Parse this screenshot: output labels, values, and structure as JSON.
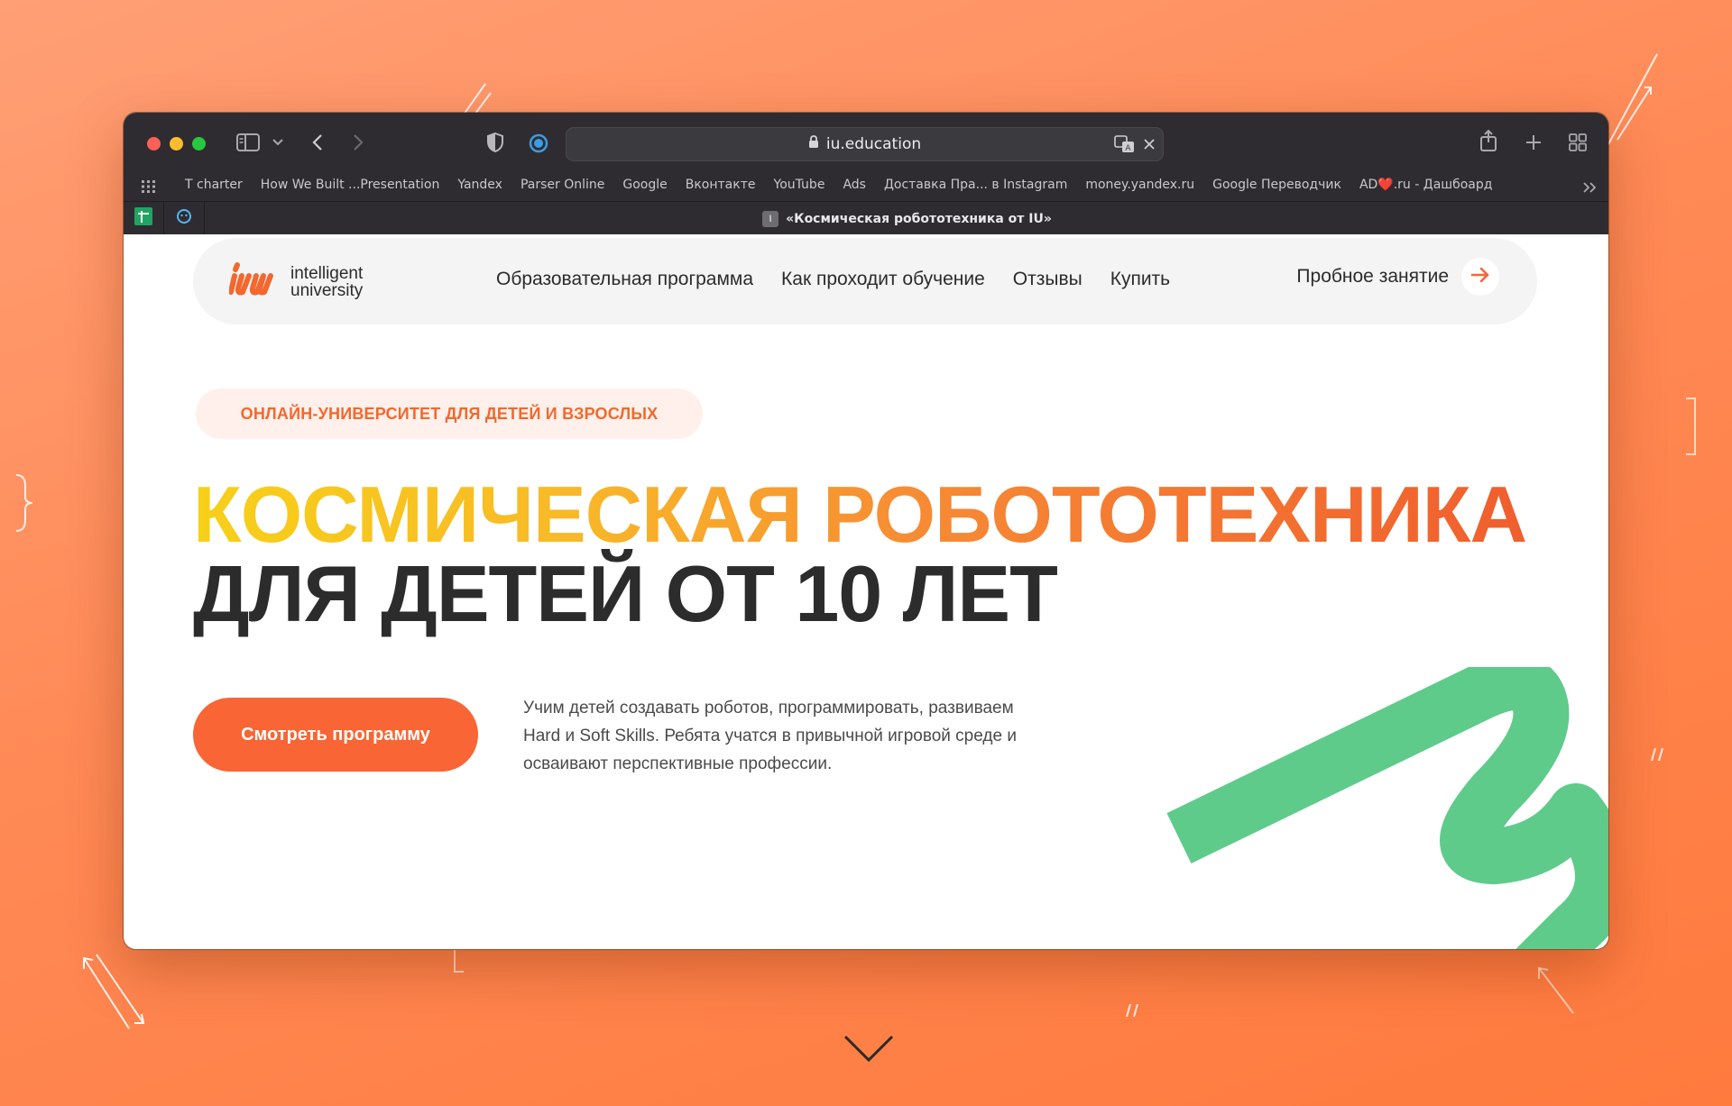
{
  "browser": {
    "url": "iu.education",
    "bookmarks": [
      "T charter",
      "How We Built ...Presentation",
      "Yandex",
      "Parser Online",
      "Google",
      "Вконтакте",
      "YouTube",
      "Ads",
      "Доставка Пра... в Instagram",
      "money.yandex.ru",
      "Google Переводчик",
      "AD❤️.ru - Дашбоард"
    ],
    "active_tab_title": "«Космическая робототехника от IU»",
    "active_tab_favicon": "I"
  },
  "site": {
    "logo_line1": "intelligent",
    "logo_line2": "university",
    "nav": [
      "Образовательная программа",
      "Как проходит обучение",
      "Отзывы",
      "Купить"
    ],
    "trial_label": "Пробное занятие",
    "badge": "ОНЛАЙН-УНИВЕРСИТЕТ ДЛЯ ДЕТЕЙ И ВЗРОСЛЫХ",
    "headline_line1": "КОСМИЧЕСКАЯ РОБОТОТЕХНИКА",
    "headline_line2": "ДЛЯ ДЕТЕЙ ОТ 10 ЛЕТ",
    "cta": "Смотреть программу",
    "description": "Учим детей создавать роботов, программировать, развиваем Hard и Soft Skills. Ребята учатся в привычной игровой среде и осваивают перспективные профессии."
  },
  "colors": {
    "accent": "#f96535",
    "badge_text": "#f2682e",
    "green_shape": "#5ecb8b",
    "headline_dark": "#2c2c2c"
  }
}
